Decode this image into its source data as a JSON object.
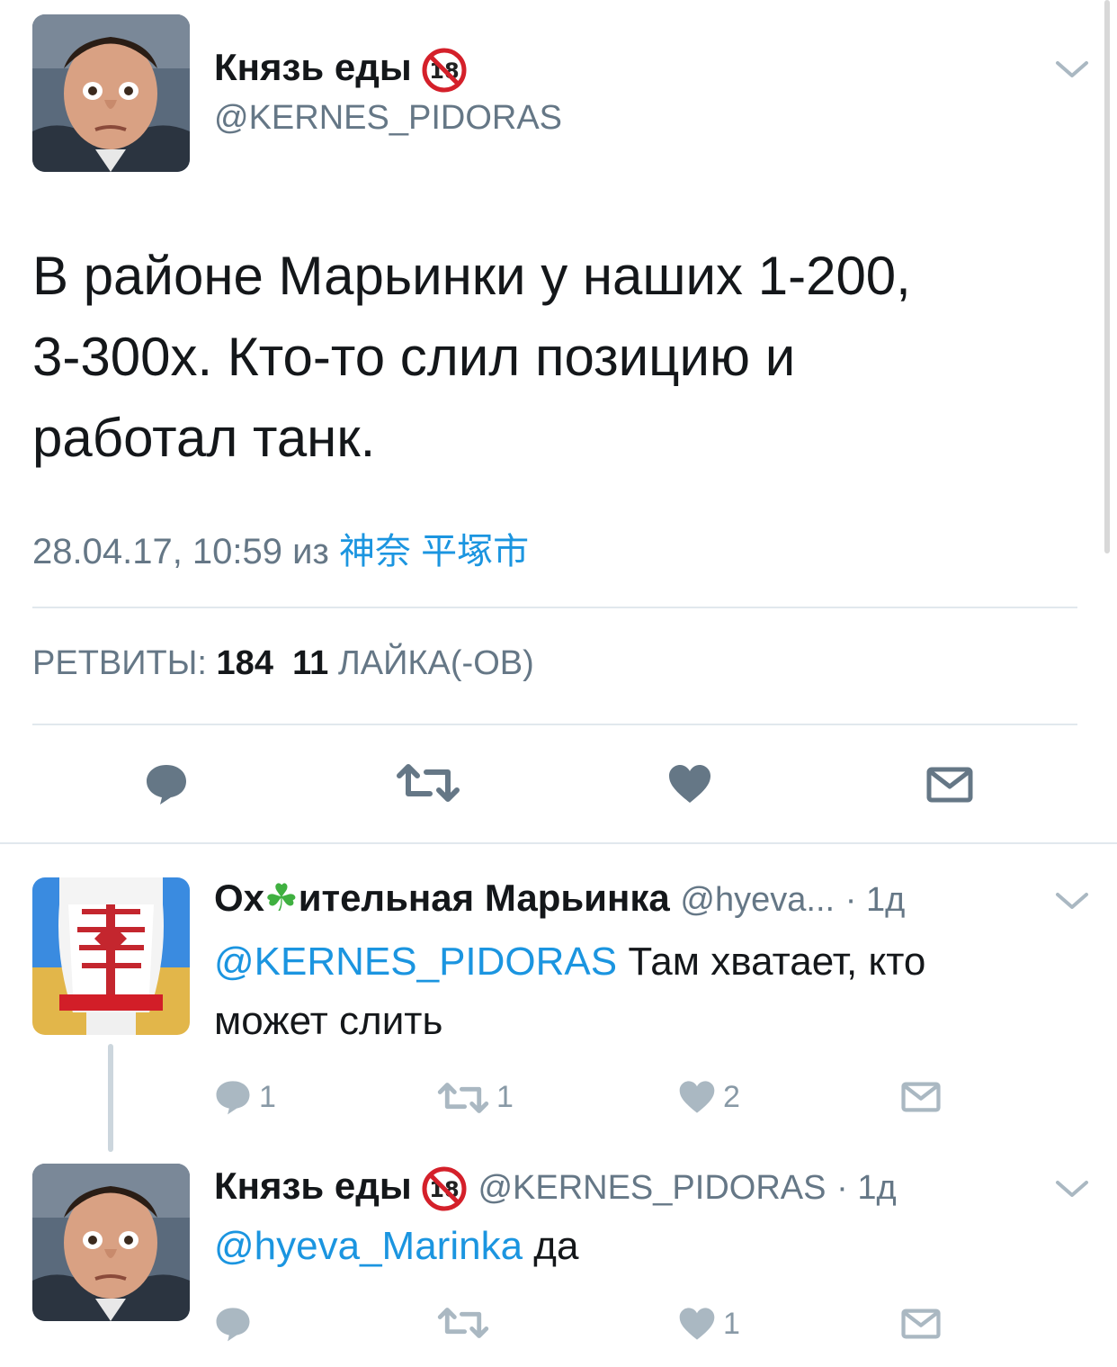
{
  "main_tweet": {
    "author_name": "Князь еды",
    "author_handle": "@KERNES_PIDORAS",
    "badge": "18",
    "text_lines": [
      "В районе Марьинки у наших 1-200,",
      "3-300х. Кто-то слил позицию и",
      "работал танк."
    ],
    "timestamp": "28.04.17, 10:59",
    "from_label": "из",
    "location": "神奈 平塚市",
    "retweets_label": "РЕТВИТЫ:",
    "retweets_count": "184",
    "likes_count": "11",
    "likes_label": "ЛАЙКА(-ОВ)"
  },
  "reply_1": {
    "author_name_part1": "Ох",
    "author_name_part2": "ительная Марьинка",
    "author_emoji": "☘",
    "author_handle": "@hyeva...",
    "time": "· 1д",
    "mention": "@KERNES_PIDORAS",
    "text_rest_line1": " Там хватает, кто",
    "text_line2": "может слить",
    "replies": "1",
    "retweets": "1",
    "likes": "2"
  },
  "reply_2": {
    "author_name": "Князь еды",
    "badge": "18",
    "author_handle": "@KERNES_PIDORAS",
    "time": "· 1д",
    "mention": "@hyeva_Marinka",
    "text_rest": " да",
    "likes": "1"
  },
  "icons": {
    "reply": "reply-icon",
    "retweet": "retweet-icon",
    "like": "heart-icon",
    "dm": "envelope-icon",
    "caret": "chevron-down-icon",
    "age": "no-under-18-icon"
  },
  "colors": {
    "link": "#1b95e0",
    "muted": "#657786",
    "icon": "#8899a6",
    "icon_dark": "#657786",
    "divider": "#e1e8ed"
  }
}
